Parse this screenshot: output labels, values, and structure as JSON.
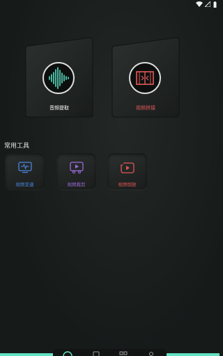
{
  "main_cards": [
    {
      "label": "音频提取",
      "color": "#ffffff"
    },
    {
      "label": "视频拼接",
      "color": "#e55a5a"
    }
  ],
  "section_title": "常用工具",
  "tools": [
    {
      "label": "视频变速",
      "color": "#4a86e0"
    },
    {
      "label": "视频裁剪",
      "color": "#9d6bde"
    },
    {
      "label": "视频倒放",
      "color": "#e35656"
    }
  ],
  "colors": {
    "accent": "#64e0c2",
    "wave": "#5ee0c4",
    "red": "#e55a5a"
  },
  "nav": {
    "icons": [
      "home-icon",
      "video-icon",
      "apps-icon",
      "profile-icon"
    ]
  }
}
